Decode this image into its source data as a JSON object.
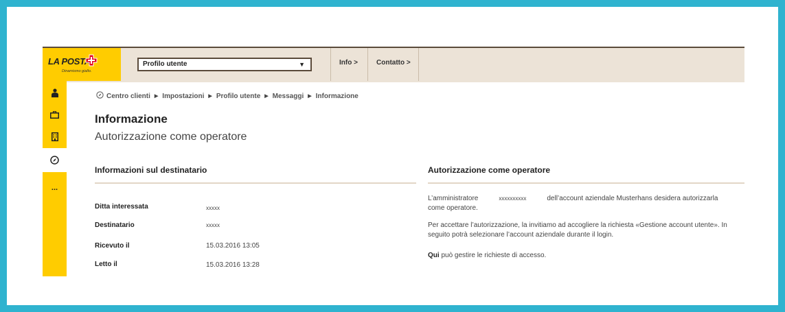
{
  "brand": {
    "logo_text": "LA POSTA",
    "tagline": "Dinamismo giallo.",
    "brand_color": "#ffcc00",
    "frame_color": "#2fb3cf"
  },
  "header": {
    "profile_select": {
      "selected": "Profilo utente"
    },
    "nav": [
      "Info >",
      "Contatto >"
    ]
  },
  "sidebar": {
    "items": [
      {
        "icon": "user-icon"
      },
      {
        "icon": "briefcase-icon"
      },
      {
        "icon": "building-icon"
      },
      {
        "icon": "compass-icon",
        "active": true
      },
      {
        "icon": "more-icon",
        "label": "..."
      }
    ]
  },
  "breadcrumb": [
    "Centro clienti",
    "Impostazioni",
    "Profilo utente",
    "Messaggi",
    "Informazione"
  ],
  "page": {
    "title": "Informazione",
    "subtitle": "Autorizzazione come operatore"
  },
  "recipient_section": {
    "title": "Informazioni sul destinatario",
    "fields": [
      {
        "label": "Ditta interessata",
        "value": "xxxxx"
      },
      {
        "label": "Destinatario",
        "value": "xxxxx"
      },
      {
        "label": "Ricevuto il",
        "value": "15.03.2016 13:05"
      },
      {
        "label": "Letto il",
        "value": "15.03.2016 13:28"
      }
    ]
  },
  "authorization_section": {
    "title": "Autorizzazione come operatore",
    "p1_start": "L’amministratore",
    "p1_redacted": "xxxxxxxxxx",
    "p1_end": "dell’account aziendale Musterhans desidera autorizzarla come operatore.",
    "p2": "Per accettare l’autorizzazione, la invitiamo ad accogliere la richiesta «Gestione account utente». In seguito potrà selezionare l’account aziendale durante il login.",
    "p3_link": "Qui",
    "p3_rest": " può gestire le richieste di accesso."
  }
}
